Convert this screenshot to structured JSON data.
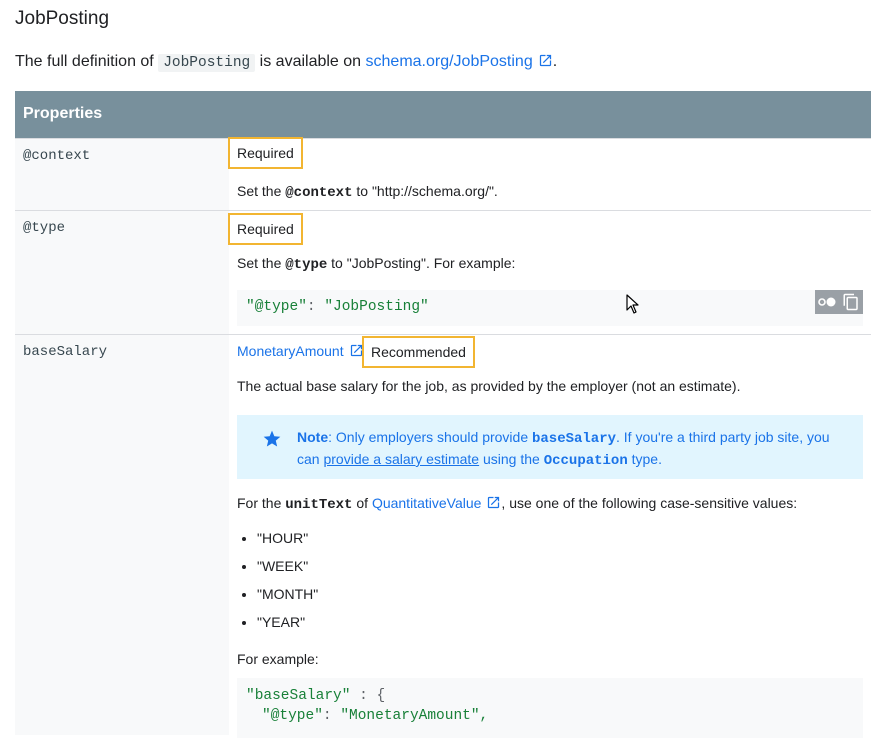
{
  "page": {
    "title": "JobPosting",
    "intro_pre": "The full definition of ",
    "intro_code": "JobPosting",
    "intro_mid": " is available on ",
    "intro_link": "schema.org/JobPosting",
    "intro_end": "."
  },
  "table": {
    "header": "Properties",
    "rows": [
      {
        "name": "@context",
        "badge": "Required",
        "desc_pre": "Set the ",
        "desc_code": "@context",
        "desc_post": " to \"http://schema.org/\"."
      },
      {
        "name": "@type",
        "badge": "Required",
        "desc_pre": "Set the ",
        "desc_code": "@type",
        "desc_post": " to \"JobPosting\". For example:",
        "code_key": "\"@type\"",
        "code_sep": ": ",
        "code_val": "\"JobPosting\""
      },
      {
        "name": "baseSalary",
        "type_link": "MonetaryAmount",
        "type_sep": ",",
        "badge": "Recommended",
        "desc": "The actual base salary for the job, as provided by the employer (not an estimate).",
        "note": {
          "label": "Note",
          "text1": ": Only employers should provide ",
          "code1": "baseSalary",
          "text2": ". If you're a third party job site, you can ",
          "link": "provide a salary estimate",
          "text3": " using the ",
          "code2": "Occupation",
          "text4": " type."
        },
        "unit_pre": "For the ",
        "unit_code": "unitText",
        "unit_mid": " of ",
        "unit_link": "QuantitativeValue",
        "unit_post": ", use one of the following case-sensitive values:",
        "units": [
          "\"HOUR\"",
          "\"WEEK\"",
          "\"MONTH\"",
          "\"YEAR\""
        ],
        "example_label": "For example:",
        "code_line1_key": "\"baseSalary\"",
        "code_line1_rest": " : {",
        "code_line2_key": "\"@type\"",
        "code_line2_sep": ": ",
        "code_line2_val": "\"MonetaryAmount\","
      }
    ]
  },
  "colors": {
    "header_bg": "#78909c",
    "badge_border": "#f2b531",
    "link": "#1a73e8",
    "note_bg": "#e1f5fe",
    "code_string": "#188038"
  },
  "icons": [
    "open-in-new-icon",
    "star-icon",
    "dark-mode-toggle-icon",
    "copy-icon",
    "mouse-cursor-icon"
  ]
}
